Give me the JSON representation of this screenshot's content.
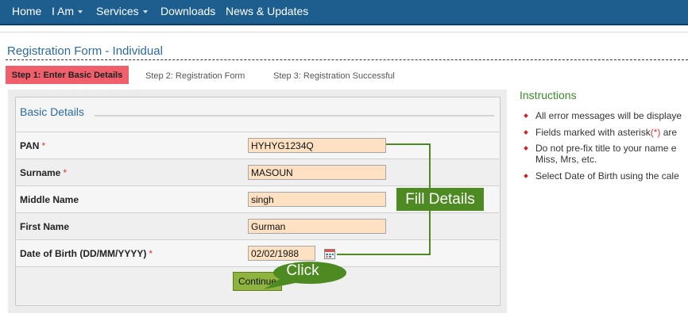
{
  "nav": {
    "items": [
      {
        "label": "Home"
      },
      {
        "label": "I Am"
      },
      {
        "label": "Services"
      },
      {
        "label": "Downloads"
      },
      {
        "label": "News & Updates"
      }
    ]
  },
  "form": {
    "title": "Registration Form - Individual",
    "steps": [
      {
        "label": "Step 1: Enter Basic Details"
      },
      {
        "label": "Step 2: Registration Form"
      },
      {
        "label": "Step 3: Registration Successful"
      }
    ],
    "section_title": "Basic Details",
    "required_marker": "*",
    "fields": {
      "pan": {
        "label": "PAN",
        "value": "HYHYG1234Q"
      },
      "surname": {
        "label": "Surname",
        "value": "MASOUN"
      },
      "middle_name": {
        "label": "Middle Name",
        "value": "singh"
      },
      "first_name": {
        "label": "First Name",
        "value": "Gurman"
      },
      "dob": {
        "label": "Date of Birth (DD/MM/YYYY)",
        "value": "02/02/1988"
      }
    },
    "continue_label": "Continue"
  },
  "instructions": {
    "title": "Instructions",
    "items": [
      {
        "text": "All error messages will be displaye"
      },
      {
        "before": "Fields marked with asterisk",
        "marker": "(*)",
        "after": " are"
      },
      {
        "line1": "Do not pre-fix title to your name e",
        "line2": "Miss, Mrs, etc."
      },
      {
        "text": "Select Date of Birth using the cale"
      }
    ]
  },
  "annotations": {
    "fill_details": "Fill Details",
    "click": "Click"
  },
  "colors": {
    "nav_bg": "#1d5e8e",
    "active_step": "#ef5f6c",
    "input_bg": "#fde1c2",
    "continue_bg": "#8fb43e",
    "annotation_green": "#4d8a22",
    "link_blue": "#2b6aa0"
  }
}
